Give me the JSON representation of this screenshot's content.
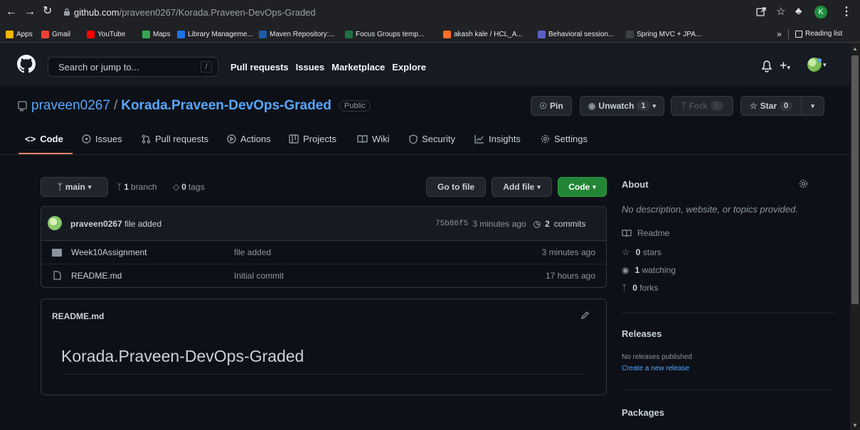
{
  "browser": {
    "url_host": "github.com",
    "url_path": "/praveen0267/Korada.Praveen-DevOps-Graded",
    "profile_initial": "K",
    "bookmarks": [
      {
        "label": "Apps",
        "color": "#f4b400"
      },
      {
        "label": "Gmail",
        "color": "#ea4335"
      },
      {
        "label": "YouTube",
        "color": "#ff0000"
      },
      {
        "label": "Maps",
        "color": "#34a853"
      },
      {
        "label": "Library Manageme...",
        "color": "#1a73e8"
      },
      {
        "label": "Maven Repository:...",
        "color": "#1a5ca8"
      },
      {
        "label": "Focus Groups temp...",
        "color": "#1e7145"
      },
      {
        "label": "akash kale / HCL_A...",
        "color": "#fc6d26"
      },
      {
        "label": "Behavioral session...",
        "color": "#5b5fc7"
      },
      {
        "label": "Spring MVC + JPA...",
        "color": "#3c4043"
      }
    ],
    "more_label": "»",
    "reading_list_label": "Reading list"
  },
  "header": {
    "search_placeholder": "Search or jump to...",
    "search_key": "/",
    "nav": [
      "Pull requests",
      "Issues",
      "Marketplace",
      "Explore"
    ]
  },
  "repo": {
    "owner": "praveen0267",
    "separator": "/",
    "name": "Korada.Praveen-DevOps-Graded",
    "visibility": "Public",
    "pin_label": "Pin",
    "unwatch_label": "Unwatch",
    "unwatch_count": "1",
    "fork_label": "Fork",
    "fork_count": "0",
    "star_label": "Star",
    "star_count": "0"
  },
  "tabs": [
    "Code",
    "Issues",
    "Pull requests",
    "Actions",
    "Projects",
    "Wiki",
    "Security",
    "Insights",
    "Settings"
  ],
  "toolbar": {
    "branch": "main",
    "branch_count": "1",
    "branch_word": "branch",
    "tag_count": "0",
    "tag_word": "tags",
    "goto_file": "Go to file",
    "add_file": "Add file",
    "code": "Code"
  },
  "commit": {
    "author": "praveen0267",
    "message": "file added",
    "hash": "75b86f5",
    "time": "3 minutes ago",
    "count": "2",
    "count_word": "commits"
  },
  "files": [
    {
      "name": "Week10Assignment",
      "type": "folder",
      "message": "file added",
      "time": "3 minutes ago"
    },
    {
      "name": "README.md",
      "type": "file",
      "message": "Initial commit",
      "time": "17 hours ago"
    }
  ],
  "readme": {
    "filename": "README.md",
    "heading": "Korada.Praveen-DevOps-Graded"
  },
  "about": {
    "title": "About",
    "description": "No description, website, or topics provided.",
    "readme": "Readme",
    "stars": "0",
    "stars_word": "stars",
    "watching": "1",
    "watching_word": "watching",
    "forks": "0",
    "forks_word": "forks"
  },
  "releases": {
    "title": "Releases",
    "none": "No releases published",
    "create": "Create a new release"
  },
  "packages": {
    "title": "Packages"
  }
}
